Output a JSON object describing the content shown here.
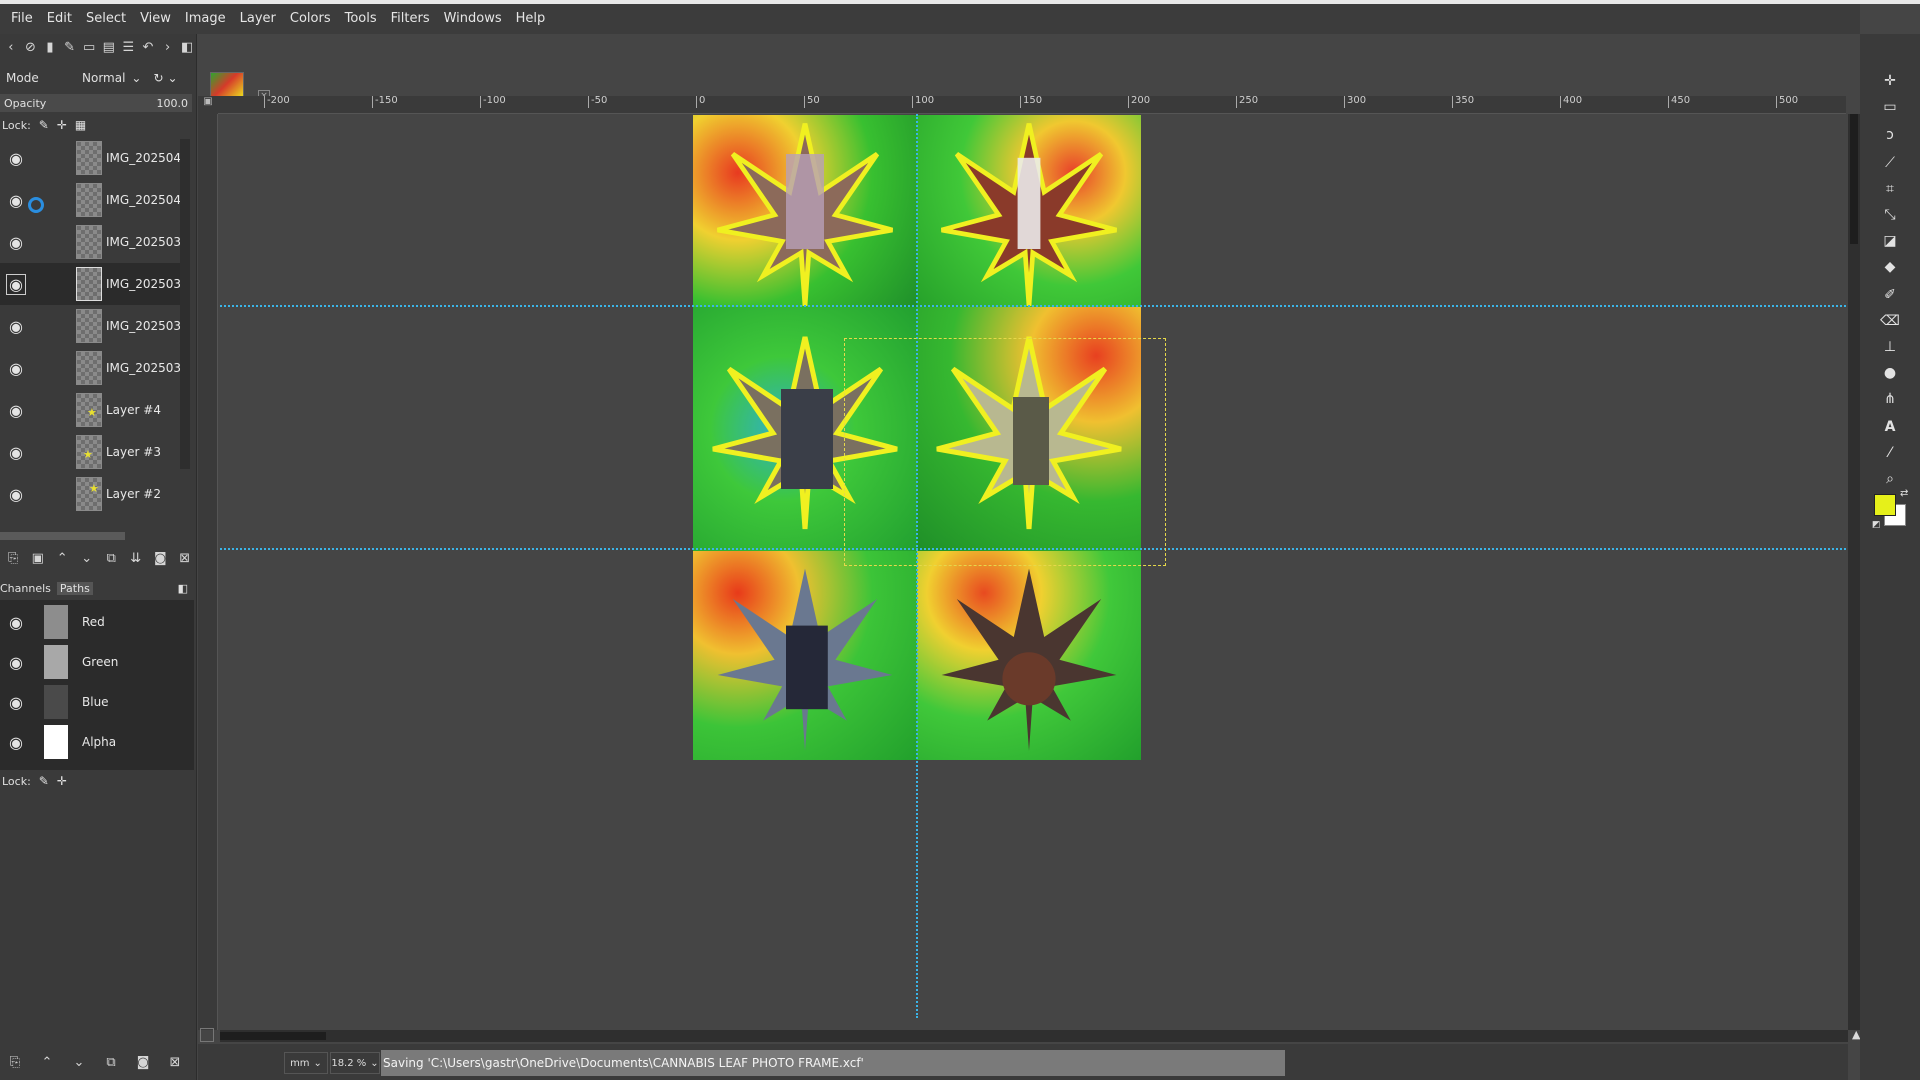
{
  "menubar": {
    "items": [
      "File",
      "Edit",
      "Select",
      "View",
      "Image",
      "Layer",
      "Colors",
      "Tools",
      "Filters",
      "Windows",
      "Help"
    ]
  },
  "layers_panel": {
    "mode_label": "Mode",
    "mode_value": "Normal",
    "opacity_label": "Opacity",
    "opacity_value": "100.0",
    "lock_label": "Lock:",
    "layers": [
      {
        "name": "IMG_202504",
        "visible": true,
        "selected": false
      },
      {
        "name": "IMG_202504",
        "visible": true,
        "selected": false
      },
      {
        "name": "IMG_202503",
        "visible": true,
        "selected": false
      },
      {
        "name": "IMG_202503",
        "visible": true,
        "selected": true
      },
      {
        "name": "IMG_202503",
        "visible": true,
        "selected": false
      },
      {
        "name": "IMG_202503",
        "visible": true,
        "selected": false
      },
      {
        "name": "Layer #4",
        "visible": true,
        "selected": false
      },
      {
        "name": "Layer #3",
        "visible": true,
        "selected": false
      },
      {
        "name": "Layer #2",
        "visible": true,
        "selected": false
      }
    ]
  },
  "channels_panel": {
    "tab_channels": "Channels",
    "tab_paths": "Paths",
    "lock_label": "Lock:",
    "channels": [
      "Red",
      "Green",
      "Blue",
      "Alpha"
    ]
  },
  "rulers": {
    "h_ticks": [
      "-200",
      "-150",
      "-100",
      "-50",
      "0",
      "50",
      "100",
      "150",
      "200",
      "250",
      "300",
      "350",
      "400",
      "450",
      "500"
    ]
  },
  "statusbar": {
    "unit": "mm",
    "zoom": "18.2 %",
    "message": "Saving 'C:\\Users\\gastr\\OneDrive\\Documents\\CANNABIS LEAF PHOTO FRAME.xcf'"
  },
  "colors": {
    "foreground": "#e6f01a",
    "background": "#ffffff",
    "guide": "#3ab4e8"
  }
}
